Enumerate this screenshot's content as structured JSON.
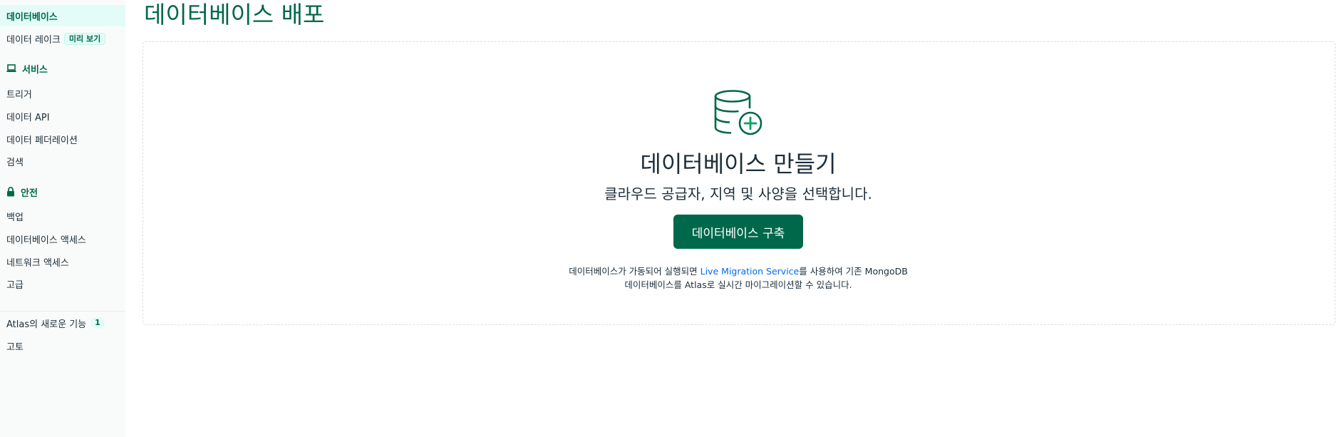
{
  "sidebar": {
    "items_top": [
      {
        "label": "데이터베이스",
        "active": true
      },
      {
        "label": "데이터 레이크",
        "badge": "미리 보기"
      }
    ],
    "services": {
      "header": "서비스",
      "icon": "laptop-icon",
      "items": [
        "트리거",
        "데이터 API",
        "데이터 페더레이션",
        "검색"
      ]
    },
    "security": {
      "header": "안전",
      "icon": "lock-icon",
      "items": [
        "백업",
        "데이터베이스 액세스",
        "네트워크 액세스",
        "고급"
      ]
    },
    "footer_items": [
      {
        "label": "Atlas의 새로운 기능",
        "badge": "1"
      },
      {
        "label": "고토"
      }
    ]
  },
  "main": {
    "title": "데이터베이스 배포",
    "empty_state": {
      "icon": "database-plus-icon",
      "heading": "데이터베이스 만들기",
      "subheading": "클라우드 공급자, 지역 및 사양을 선택합니다.",
      "button": "데이터베이스 구축",
      "note_pre": "데이터베이스가 가동되어 실행되면 ",
      "note_link": "Live Migration Service",
      "note_post1": "를 사용하여 기존 MongoDB",
      "note_post2": "데이터베이스를 Atlas로 실시간 마이그레이션할 수 있습니다."
    }
  },
  "colors": {
    "brand_green": "#00684a",
    "active_bg": "#e3fcf7",
    "link_blue": "#016bf8",
    "icon_accent": "#00a35c"
  }
}
